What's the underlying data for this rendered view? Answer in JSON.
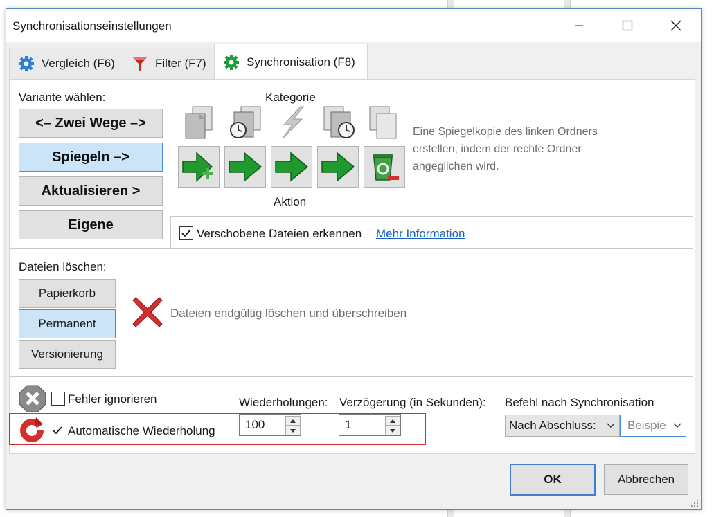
{
  "window": {
    "title": "Synchronisationseinstellungen"
  },
  "tabs": [
    {
      "label": "Vergleich (F6)",
      "icon": "gear-icon"
    },
    {
      "label": "Filter (F7)",
      "icon": "filter-icon"
    },
    {
      "label": "Synchronisation (F8)",
      "icon": "gear-green-icon",
      "active": true
    }
  ],
  "variant": {
    "heading": "Variante wählen:",
    "buttons": [
      "<– Zwei Wege –>",
      "Spiegeln –>",
      "Aktualisieren >",
      "Eigene"
    ],
    "selected": "Spiegeln –>"
  },
  "category": {
    "label": "Kategorie"
  },
  "action": {
    "label": "Aktion"
  },
  "description": "Eine Spiegelkopie des linken Ordners erstellen, indem der rechte Ordner angeglichen wird.",
  "detect_moved": {
    "label": "Verschobene Dateien erkennen",
    "checked": true,
    "link": "Mehr Information"
  },
  "delete_files": {
    "heading": "Dateien löschen:",
    "buttons": [
      "Papierkorb",
      "Permanent",
      "Versionierung"
    ],
    "selected": "Permanent",
    "description": "Dateien endgültig löschen und überschreiben"
  },
  "errors": {
    "ignore_label": "Fehler ignorieren",
    "ignore_checked": false,
    "auto_retry_label": "Automatische Wiederholung",
    "auto_retry_checked": true,
    "retries_label": "Wiederholungen:",
    "retries_value": "100",
    "delay_label": "Verzögerung (in Sekunden):",
    "delay_value": "1"
  },
  "post_sync": {
    "label": "Befehl nach Synchronisation",
    "combo_value": "Nach Abschluss:",
    "command_placeholder": "Beispie"
  },
  "footer": {
    "ok": "OK",
    "cancel": "Abbrechen"
  },
  "colors": {
    "accent": "#4a8fd4",
    "selected_bg": "#cce4f7",
    "red_box": "#d32f2f",
    "link": "#1a64c4"
  }
}
